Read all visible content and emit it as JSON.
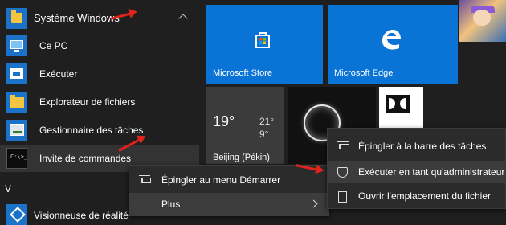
{
  "app_list": {
    "group": {
      "label": "Système Windows",
      "icon": "folder-icon"
    },
    "items": [
      {
        "label": "Ce PC",
        "icon": "computer-icon"
      },
      {
        "label": "Exécuter",
        "icon": "run-icon"
      },
      {
        "label": "Explorateur de fichiers",
        "icon": "folder-icon"
      },
      {
        "label": "Gestionnaire des tâches",
        "icon": "task-manager-icon"
      },
      {
        "label": "Invite de commandes",
        "icon": "command-prompt-icon",
        "icon_text": "C:\\>_"
      }
    ],
    "section_letter": "V",
    "visionneuse_label": "Visionneuse de réalité"
  },
  "tiles": {
    "store": {
      "label": "Microsoft Store",
      "icon": "store-bag-icon"
    },
    "edge": {
      "label": "Microsoft Edge",
      "icon": "edge-logo-icon"
    },
    "weather": {
      "temp": "19°",
      "temp_high": "21°",
      "temp_low": "9°",
      "city": "Beijing (Pékin)"
    }
  },
  "context_menu_left": {
    "items": [
      {
        "label": "Épingler au menu Démarrer",
        "icon": "pin-icon"
      },
      {
        "label": "Plus",
        "icon": "chevron-right-icon"
      }
    ]
  },
  "context_menu_right": {
    "items": [
      {
        "label": "Épingler à la barre des tâches",
        "icon": "pin-icon"
      },
      {
        "label": "Exécuter en tant qu'administrateur",
        "icon": "shield-icon"
      },
      {
        "label": "Ouvrir l'emplacement du fichier",
        "icon": "file-icon"
      }
    ]
  },
  "colors": {
    "accent": "#0a74d6",
    "menu_bg": "#2b2b2b",
    "annotation_arrow": "#e0231c",
    "background": "#1f1f1f"
  }
}
